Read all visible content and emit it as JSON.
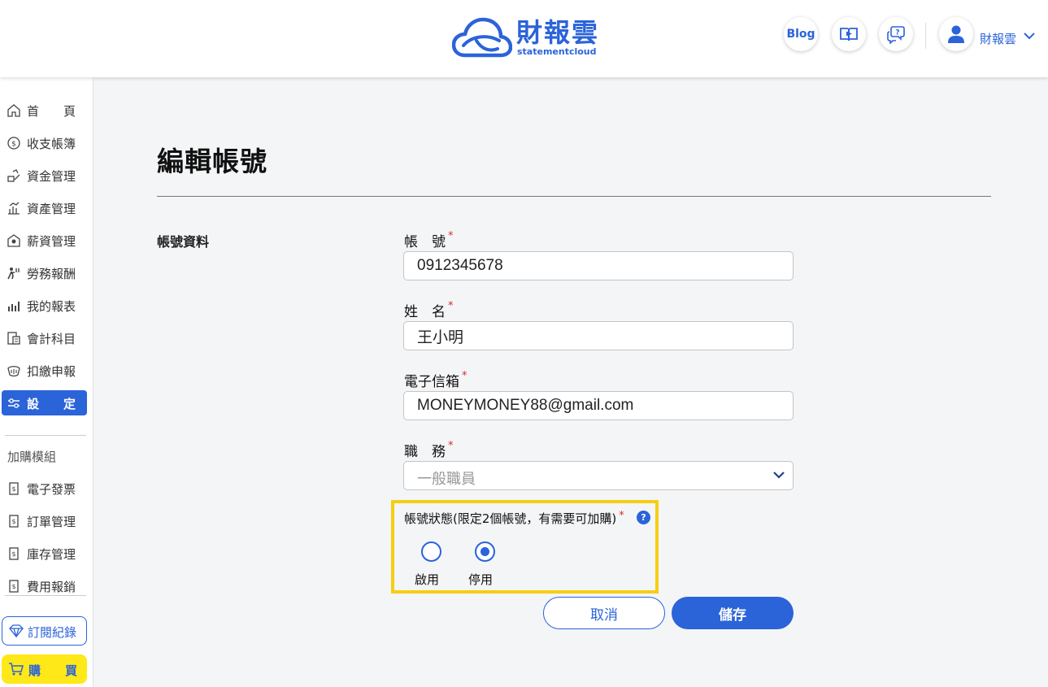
{
  "header": {
    "logo_cn": "財報雲",
    "logo_en": "statementcloud",
    "blog_label": "Blog",
    "user_name": "財報雲"
  },
  "sidebar": {
    "items": [
      {
        "label": "首　　頁",
        "icon": "home-icon"
      },
      {
        "label": "收支帳簿",
        "icon": "dollar-coin-icon"
      },
      {
        "label": "資金管理",
        "icon": "funds-icon"
      },
      {
        "label": "資產管理",
        "icon": "assets-icon"
      },
      {
        "label": "薪資管理",
        "icon": "payroll-icon"
      },
      {
        "label": "勞務報酬",
        "icon": "labor-icon"
      },
      {
        "label": "我的報表",
        "icon": "bar-chart-icon"
      },
      {
        "label": "會計科目",
        "icon": "accounting-icon"
      },
      {
        "label": "扣繳申報",
        "icon": "withholding-icon"
      },
      {
        "label": "設　　定",
        "icon": "settings-sliders-icon"
      }
    ],
    "addon_section": "加購模組",
    "addons": [
      {
        "label": "電子發票",
        "icon": "invoice-icon"
      },
      {
        "label": "訂單管理",
        "icon": "order-icon"
      },
      {
        "label": "庫存管理",
        "icon": "inventory-icon"
      },
      {
        "label": "費用報銷",
        "icon": "expense-icon"
      }
    ],
    "subscription_label": "訂閱紀錄",
    "buy_label": "購　　買"
  },
  "main": {
    "title": "編輯帳號",
    "section_title": "帳號資料",
    "fields": {
      "account_label": "帳　號",
      "account_value": "0912345678",
      "name_label": "姓　名",
      "name_value": "王小明",
      "email_label": "電子信箱",
      "email_value": "MONEYMONEY88@gmail.com",
      "role_label": "職　務",
      "role_value": "一般職員"
    },
    "required_mark": "*",
    "status": {
      "label": "帳號狀態(限定2個帳號，有需要可加購)",
      "help": "?",
      "options": [
        "啟用",
        "停用"
      ],
      "selected": "停用"
    },
    "cancel_label": "取消",
    "save_label": "儲存"
  },
  "colors": {
    "accent": "#2b63d9",
    "highlight": "#f6ce12",
    "buy": "#ffe817",
    "required": "#d32f2f"
  }
}
